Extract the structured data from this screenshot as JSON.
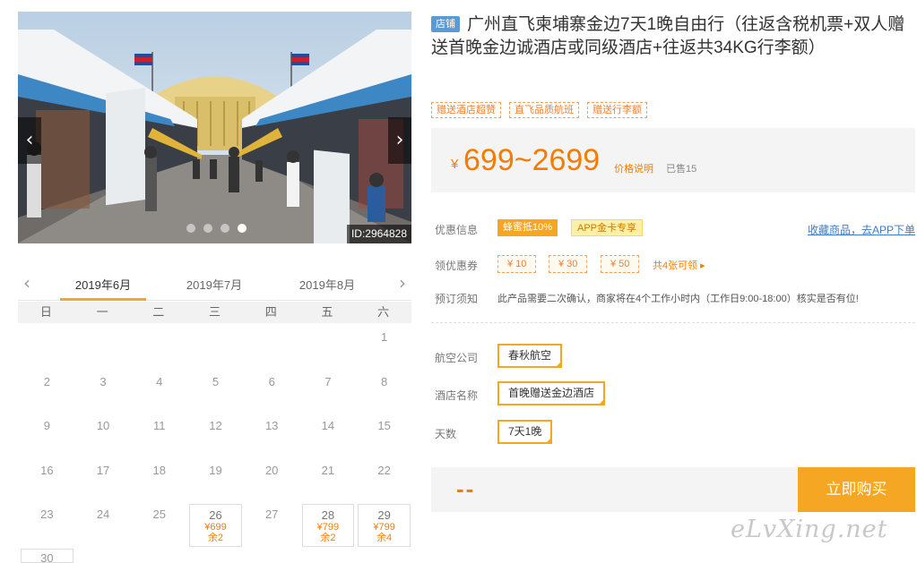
{
  "photo": {
    "prev_icon": "‹",
    "next_icon": "›",
    "id_label": "ID:2964828",
    "slide_count": 4,
    "active_slide": 4
  },
  "calendar": {
    "prev_icon": "‹",
    "next_icon": "›",
    "months": [
      "2019年6月",
      "2019年7月",
      "2019年8月"
    ],
    "active_month": 0,
    "weekdays": [
      "日",
      "一",
      "二",
      "三",
      "四",
      "五",
      "六"
    ],
    "first_weekday": 6,
    "days_in_month": 30,
    "available": [
      {
        "day": "26",
        "price": "¥699",
        "stock": "余2"
      },
      {
        "day": "28",
        "price": "¥799",
        "stock": "余2"
      },
      {
        "day": "29",
        "price": "¥799",
        "stock": "余4"
      }
    ]
  },
  "product": {
    "shop_badge": "店铺",
    "title": "广州直飞柬埔寨金边7天1晚自由行（往返含税机票+双人赠送首晚金边诚酒店或同级酒店+往返共34KG行李额）",
    "tags": [
      "赠送酒店超赞",
      "直飞品质航班",
      "赠送行李额"
    ],
    "price_symbol": "¥",
    "price_range": "699~2699",
    "price_note": "价格说明",
    "sold": "已售15"
  },
  "info": {
    "promo_label": "优惠信息",
    "promo_badge1": "蜂蜜抵10%",
    "promo_badge2": "APP金卡专享",
    "collect_link": "收藏商品，去APP下单",
    "coupon_label": "领优惠券",
    "coupons": [
      "¥ 10",
      "¥ 30",
      "¥ 50"
    ],
    "coupon_more": "共4张可领 ▸",
    "notice_label": "预订须知",
    "notice_text": "此产品需要二次确认，商家将在4个工作小时内（工作日9:00-18:00）核实是否有位!"
  },
  "options": {
    "airline_label": "航空公司",
    "airline_value": "春秋航空",
    "hotel_label": "酒店名称",
    "hotel_value": "首晚赠送金边酒店",
    "days_label": "天数",
    "days_value": "7天1晚"
  },
  "buy": {
    "total": "--",
    "button": "立即购买"
  },
  "watermark": "eLvXing.net",
  "colors": {
    "accent": "#f5a623",
    "price": "#f57c00",
    "link": "#3d7cc9",
    "badge_blue": "#5b9bd5"
  }
}
